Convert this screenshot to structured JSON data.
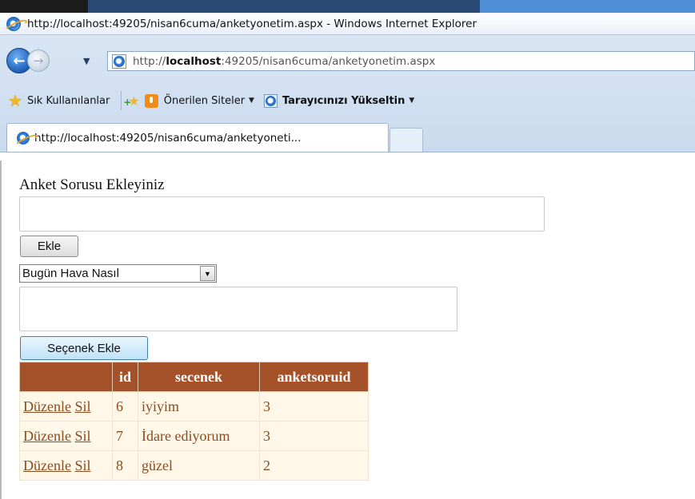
{
  "window": {
    "title": "http://localhost:49205/nisan6cuma/anketyonetim.aspx - Windows Internet Explorer"
  },
  "address_bar": {
    "prefix": "http://",
    "host": "localhost",
    "rest": ":49205/nisan6cuma/anketyonetim.aspx"
  },
  "favorites_bar": {
    "favorites_label": "Sık Kullanılanlar",
    "suggested_sites_label": "Önerilen Siteler",
    "upgrade_label": "Tarayıcınızı Yükseltin"
  },
  "tabs": [
    {
      "label": "http://localhost:49205/nisan6cuma/anketyoneti..."
    }
  ],
  "form": {
    "question_label": "Anket Sorusu Ekleyiniz",
    "question_value": "",
    "add_button": "Ekle",
    "question_select": {
      "selected": "Bugün Hava Nasıl"
    },
    "option_value": "",
    "add_option_button": "Seçenek Ekle"
  },
  "grid": {
    "columns": [
      "",
      "id",
      "secenek",
      "anketsoruid"
    ],
    "edit_label": "Düzenle",
    "delete_label": "Sil",
    "rows": [
      {
        "id": "6",
        "secenek": "iyiyim",
        "anketsoruid": "3"
      },
      {
        "id": "7",
        "secenek": "İdare ediyorum",
        "anketsoruid": "3"
      },
      {
        "id": "8",
        "secenek": "güzel",
        "anketsoruid": "2"
      }
    ]
  },
  "colors": {
    "grid_header_bg": "#a55129",
    "grid_row_bg": "#fff7e7",
    "grid_text": "#8b4c1f"
  },
  "icons": {
    "back": "back-arrow-icon",
    "forward": "forward-arrow-icon",
    "browser": "internet-explorer-icon",
    "favorites": "star-icon",
    "suggested": "suggested-sites-icon"
  }
}
